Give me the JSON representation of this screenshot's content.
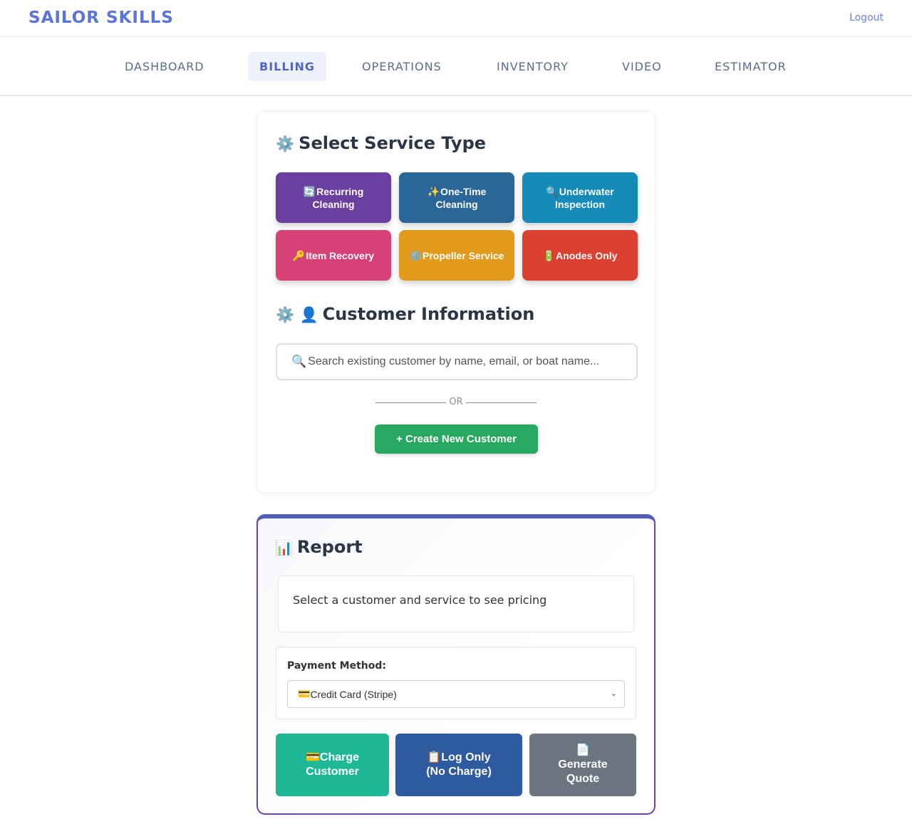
{
  "header": {
    "brand": "SAILOR SKILLS",
    "logout": "Logout"
  },
  "nav": {
    "items": [
      {
        "label": "DASHBOARD"
      },
      {
        "label": "BILLING",
        "active": true
      },
      {
        "label": "OPERATIONS"
      },
      {
        "label": "INVENTORY"
      },
      {
        "label": "VIDEO"
      },
      {
        "label": "ESTIMATOR"
      }
    ]
  },
  "service": {
    "icon": "⚙️",
    "title": "Select Service Type",
    "buttons": [
      {
        "icon": "🔄",
        "label": "Recurring Cleaning",
        "color": "#6a3fa0"
      },
      {
        "icon": "✨",
        "label": "One-Time Cleaning",
        "color": "#2a6697"
      },
      {
        "icon": "🔍",
        "label": "Underwater Inspection",
        "color": "#168ab8"
      },
      {
        "icon": "🔑",
        "label": "Item Recovery",
        "color": "#d64278"
      },
      {
        "icon": "⚙️",
        "label": "Propeller Service",
        "color": "#e19a1c"
      },
      {
        "icon": "🔋",
        "label": "Anodes Only",
        "color": "#dc4030"
      }
    ]
  },
  "customer": {
    "icons": "⚙️ 👤",
    "title": "Customer Information",
    "search_icon": "🔍",
    "search_placeholder": "Search existing customer by name, email, or boat name...",
    "or_label": "OR",
    "create_button": "+ Create New Customer"
  },
  "report": {
    "icon": "📊",
    "title": "Report",
    "pricing_text": "Select a customer and service to see pricing",
    "payment_label": "Payment Method:",
    "payment_icon": "💳",
    "payment_selected": "Credit Card (Stripe)",
    "actions": [
      {
        "icon": "💳",
        "label_line1": "Charge",
        "label_line2": "Customer",
        "color": "#1eb896"
      },
      {
        "icon": "📋",
        "label_line1": "Log Only",
        "label_line2": "(No Charge)",
        "color": "#2e5aa0"
      },
      {
        "icon": "📄",
        "label_line1": "Generate",
        "label_line2": "Quote",
        "color": "#6c757f"
      }
    ]
  }
}
